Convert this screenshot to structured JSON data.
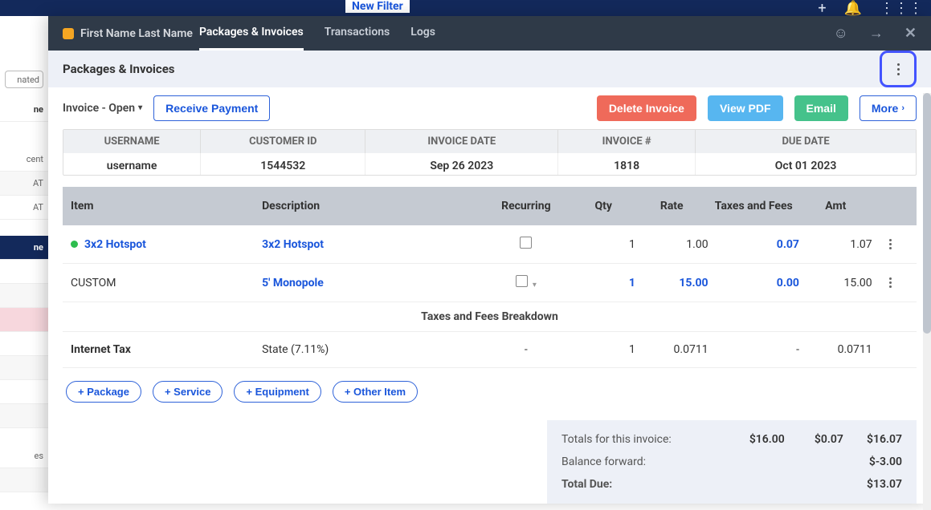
{
  "topbar": {
    "new_filter": "New Filter"
  },
  "leftbg": {
    "pill1": "nated",
    "labels": [
      "ne",
      "cent",
      "AT",
      "AT",
      "ne",
      "",
      "",
      "",
      "",
      "",
      "es"
    ]
  },
  "header": {
    "username": "First Name Last Name",
    "tabs": [
      "Packages & Invoices",
      "Transactions",
      "Logs"
    ],
    "active_tab_index": 0
  },
  "subhead": {
    "title": "Packages & Invoices"
  },
  "actionbar": {
    "status_dd": "Invoice - Open",
    "receive": "Receive Payment",
    "delete": "Delete Invoice",
    "view_pdf": "View PDF",
    "email": "Email",
    "more": "More"
  },
  "info": {
    "headers": [
      "USERNAME",
      "CUSTOMER ID",
      "INVOICE DATE",
      "INVOICE #",
      "DUE DATE"
    ],
    "values": {
      "username": "username",
      "customer_id": "1544532",
      "invoice_date": "Sep 26 2023",
      "invoice_no": "1818",
      "due_date": "Oct 01 2023"
    }
  },
  "items": {
    "headers": [
      "Item",
      "Description",
      "Recurring",
      "Qty",
      "Rate",
      "Taxes and Fees",
      "Amt"
    ],
    "rows": [
      {
        "status_color": "#2dbd4e",
        "item": "3x2 Hotspot",
        "desc": "3x2 Hotspot",
        "recurring": false,
        "qty": "1",
        "rate": "1.00",
        "tax": "0.07",
        "amt": "1.07",
        "item_link": true,
        "desc_link": true,
        "qty_link": false,
        "rate_link": false,
        "tax_link": true
      },
      {
        "status_color": "",
        "item": "CUSTOM",
        "desc": "5' Monopole",
        "recurring": false,
        "has_caret": true,
        "qty": "1",
        "rate": "15.00",
        "tax": "0.00",
        "amt": "15.00",
        "item_link": false,
        "desc_link": true,
        "qty_link": true,
        "rate_link": true,
        "tax_link": true
      }
    ],
    "breakdown_label": "Taxes and Fees Breakdown",
    "tax_rows": [
      {
        "item": "Internet Tax",
        "desc": "State (7.11%)",
        "recurring": "-",
        "qty": "1",
        "rate": "0.0711",
        "tax": "-",
        "amt": "0.0711"
      }
    ]
  },
  "addbtns": {
    "package": "+ Package",
    "service": "+ Service",
    "equipment": "+ Equipment",
    "other": "+ Other Item"
  },
  "totals": {
    "label_totals": "Totals for this invoice:",
    "t1": "$16.00",
    "t2": "$0.07",
    "t3": "$16.07",
    "label_balance": "Balance forward:",
    "balance": "$-3.00",
    "label_due": "Total Due:",
    "due": "$13.07"
  }
}
